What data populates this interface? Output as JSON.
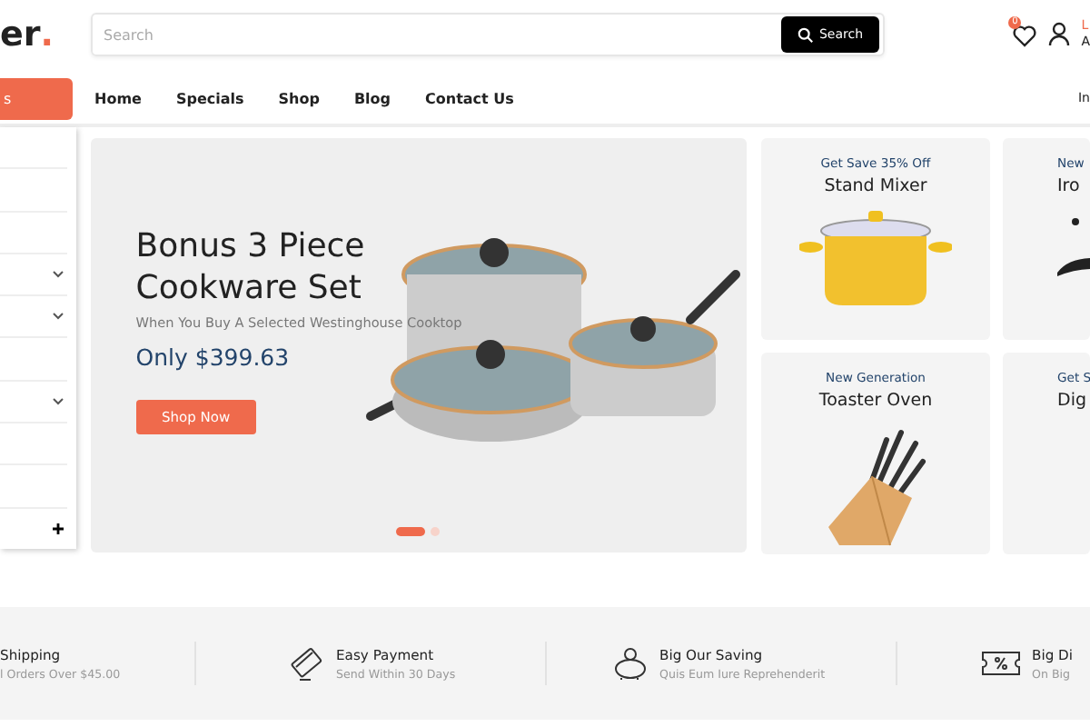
{
  "header": {
    "logo_text": "er",
    "logo_dot": ".",
    "search": {
      "placeholder": "Search",
      "button": "Search"
    },
    "wishlist_count": "0",
    "account_line_1": "L",
    "account_line_2": "A"
  },
  "nav": {
    "category_button": "s",
    "links": [
      "Home",
      "Specials",
      "Shop",
      "Blog",
      "Contact Us"
    ],
    "right_text": "In"
  },
  "sidebar": {
    "items": [
      {
        "kind": "plain"
      },
      {
        "kind": "plain"
      },
      {
        "kind": "plain"
      },
      {
        "kind": "dropdown"
      },
      {
        "kind": "dropdown"
      },
      {
        "kind": "plain"
      },
      {
        "kind": "dropdown"
      },
      {
        "kind": "plain"
      },
      {
        "kind": "plain"
      },
      {
        "kind": "more"
      }
    ]
  },
  "hero": {
    "title": "Bonus 3 Piece Cookware Set",
    "subtitle": "When You Buy A Selected Westinghouse Cooktop",
    "price": "Only $399.63",
    "button": "Shop Now",
    "dots": [
      {
        "selected": true
      },
      {
        "selected": false
      }
    ]
  },
  "promos": [
    {
      "tagline": "Get Save 35% Off",
      "title": "Stand Mixer"
    },
    {
      "tagline": "New",
      "title": "Iro"
    },
    {
      "tagline": "New Generation",
      "title": "Toaster Oven"
    },
    {
      "tagline": "Get S",
      "title": "Dig"
    }
  ],
  "features": [
    {
      "title": "Shipping",
      "text": "l Orders Over $45.00"
    },
    {
      "title": "Easy Payment",
      "text": "Send Within 30 Days"
    },
    {
      "title": "Big Our Saving",
      "text": "Quis Eum Iure Reprehenderit"
    },
    {
      "title": "Big Di",
      "text": "On Big"
    }
  ]
}
